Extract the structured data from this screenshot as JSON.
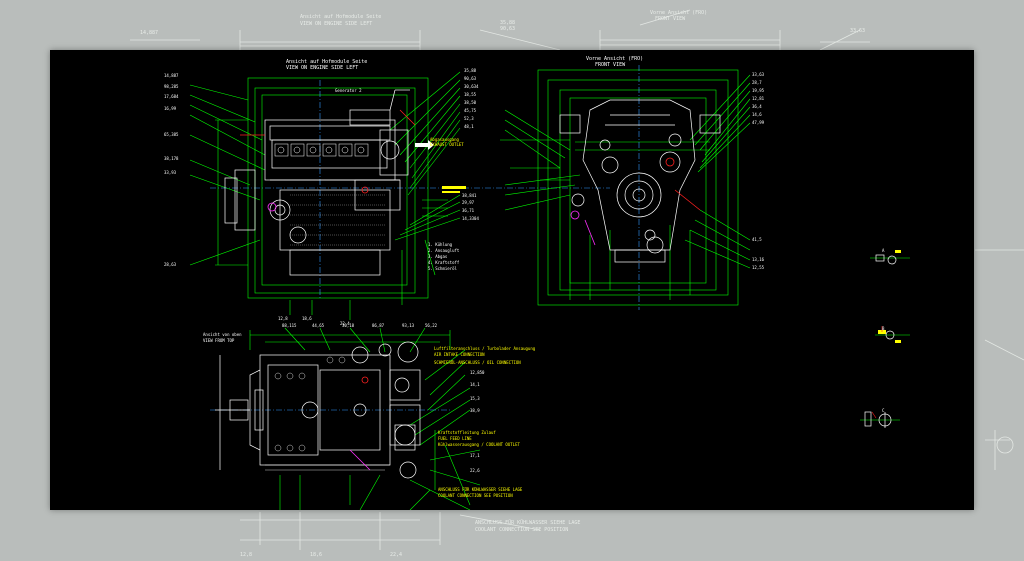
{
  "drawing": {
    "side_view": {
      "title": "Ansicht auf Hofmodule Seite",
      "subtitle": "VIEW ON ENGINE SIDE LEFT",
      "exhaust_label_1": "Abgasausgang",
      "exhaust_label_2": "EXHAUST OUTLET",
      "center_note": "Generator 2",
      "dims_right": [
        "35,88",
        "90,63",
        "30,634",
        "18,55",
        "38,50",
        "45,75",
        "52,3",
        "48,1"
      ],
      "dims_left": [
        "14,887",
        "98,285",
        "17,684",
        "16,99",
        "65,385",
        "38,178",
        "33,93",
        "28,63"
      ],
      "dims_lower_right": [
        "38,841",
        "29,97",
        "36,71",
        "14,3304"
      ],
      "callout_list": [
        "1. Kühlung",
        "2. Ansaugluft",
        "3. Abgas",
        "4. Kraftstoff",
        "5. Schmieröl"
      ],
      "bottom_dims": [
        "12,8",
        "18,6",
        "22,4"
      ]
    },
    "front_view": {
      "title": "Vorne Ansicht (FRO)",
      "subtitle": "FRONT VIEW",
      "dims_right": [
        "33,63",
        "28,7",
        "19,95",
        "12,81",
        "36,4",
        "14,6",
        "47,99",
        "41,5",
        "13,16",
        "12,55"
      ]
    },
    "top_view": {
      "title": "Ansicht von oben",
      "subtitle": "VIEW FROM TOP",
      "dims_top": [
        "88,115",
        "44,65",
        "30,18",
        "86,87",
        "93,13",
        "56,22"
      ],
      "notes": [
        "Luftfilteranschluss / Turbolader Ansaugung",
        "AIR INTAKE CONNECTION",
        "SCHMIERÖL-ANSCHLUSS / OIL CONNECTION",
        "Kraftstoffleitung Zulauf",
        "FUEL FEED LINE",
        "Kühlwasserausgang / COOLANT OUTLET",
        "ANSCHLUSS FÜR KÜHLWASSER SIEHE LAGE",
        "COOLANT CONNECTION SEE POSITION"
      ],
      "dims_right": [
        "12,850",
        "14,1",
        "15,3",
        "38,9",
        "17,1",
        "22,6"
      ]
    },
    "legend_details": [
      "A",
      "B",
      "C"
    ]
  },
  "colors": {
    "geometry": "#ffffff",
    "dimension": "#00ff00",
    "text": "#ffff00",
    "accent": "#ff2020",
    "blue": "#3399ff",
    "magenta": "#ff30ff"
  }
}
